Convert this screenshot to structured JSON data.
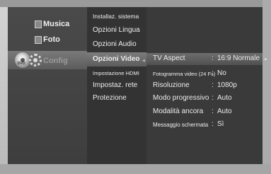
{
  "main_menu": [
    {
      "label": "Musica",
      "icon": "music-icon"
    },
    {
      "label": "Foto",
      "icon": "photo-icon"
    },
    {
      "label": "Config",
      "icon": "gear-icon"
    }
  ],
  "disc_label": "DVD",
  "submenu": [
    {
      "label": "Installaz. sistema"
    },
    {
      "label": "Opzioni Lingua"
    },
    {
      "label": "Opzioni Audio"
    },
    {
      "label": "Opzioni Video"
    },
    {
      "label": "Impostazione HDMI"
    },
    {
      "label": "Impostaz. rete"
    },
    {
      "label": "Protezione"
    }
  ],
  "video_options": [
    {
      "label": "TV Aspect",
      "separator": ":",
      "value": "16:9 Normale"
    },
    {
      "label": "Fotogramma video (24 Fs)",
      "separator": ":",
      "value": "No"
    },
    {
      "label": "Risoluzione",
      "separator": ":",
      "value": "1080p"
    },
    {
      "label": "Modo progressivo",
      "separator": ":",
      "value": "Auto"
    },
    {
      "label": "Modalità ancora",
      "separator": ":",
      "value": "Auto"
    },
    {
      "label": "Messaggio schermata",
      "separator": ":",
      "value": "Sì"
    }
  ],
  "colors": {
    "highlight": "#6e6e6e",
    "panel_bg": "#3a3a3a",
    "text": "#ececec"
  }
}
